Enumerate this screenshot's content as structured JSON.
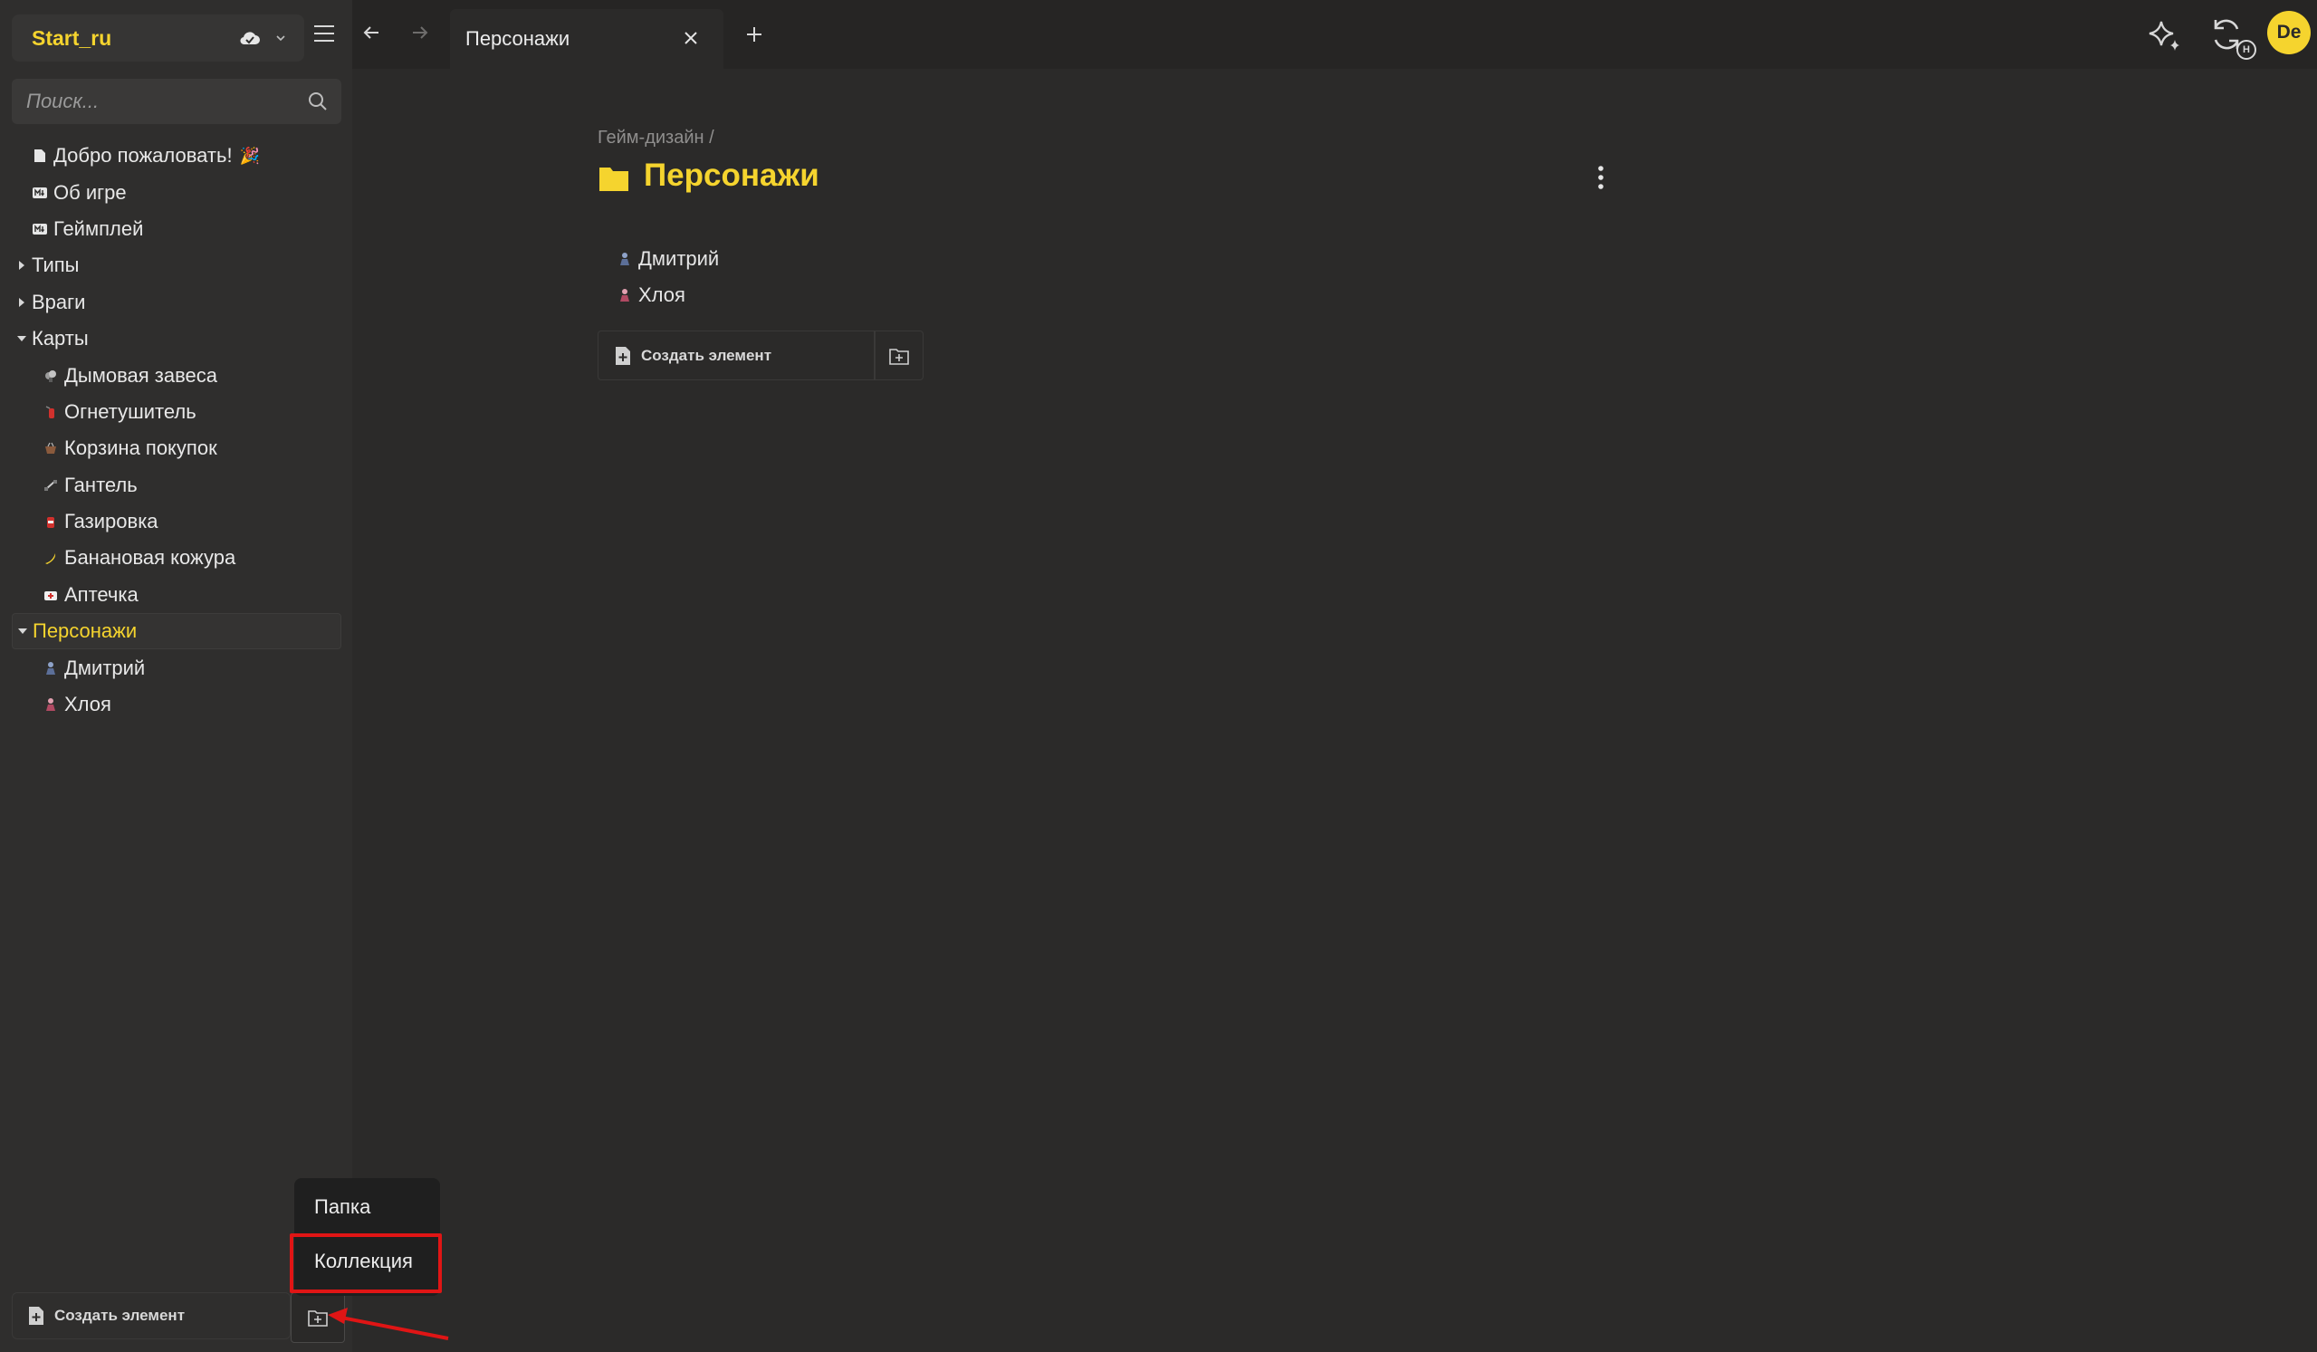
{
  "workspace": {
    "name": "Start_ru"
  },
  "search": {
    "placeholder": "Поиск..."
  },
  "sidebar": {
    "top_items": [
      {
        "label": "Добро пожаловать!",
        "icon": "page-icon",
        "extra": "🎉"
      },
      {
        "label": "Об игре",
        "icon": "markdown-icon"
      },
      {
        "label": "Геймплей",
        "icon": "markdown-icon"
      }
    ],
    "folders": [
      {
        "label": "Типы",
        "expanded": false
      },
      {
        "label": "Враги",
        "expanded": false
      },
      {
        "label": "Карты",
        "expanded": true,
        "children": [
          {
            "label": "Дымовая завеса",
            "icon": "smoke-bomb-icon"
          },
          {
            "label": "Огнетушитель",
            "icon": "extinguisher-icon"
          },
          {
            "label": "Корзина покупок",
            "icon": "basket-icon"
          },
          {
            "label": "Гантель",
            "icon": "dumbbell-icon"
          },
          {
            "label": "Газировка",
            "icon": "soda-icon"
          },
          {
            "label": "Банановая кожура",
            "icon": "banana-icon"
          },
          {
            "label": "Аптечка",
            "icon": "medkit-icon"
          }
        ]
      },
      {
        "label": "Персонажи",
        "expanded": true,
        "selected": true,
        "children": [
          {
            "label": "Дмитрий",
            "icon": "character-icon"
          },
          {
            "label": "Хлоя",
            "icon": "character-icon"
          }
        ]
      }
    ],
    "create_label": "Создать элемент"
  },
  "popup": {
    "items": [
      "Папка",
      "Коллекция"
    ],
    "highlighted": "Коллекция"
  },
  "tabs": [
    {
      "title": "Персонажи",
      "active": true
    }
  ],
  "page": {
    "breadcrumb": "Гейм-дизайн /",
    "title": "Персонажи",
    "items": [
      "Дмитрий",
      "Хлоя"
    ],
    "create_label": "Создать элемент"
  },
  "user": {
    "initials": "De"
  },
  "sync": {
    "badge": "H"
  },
  "colors": {
    "accent": "#f5d42e",
    "background": "#2b2a29",
    "sidebar": "#2f2e2d",
    "highlight": "#e01515"
  }
}
